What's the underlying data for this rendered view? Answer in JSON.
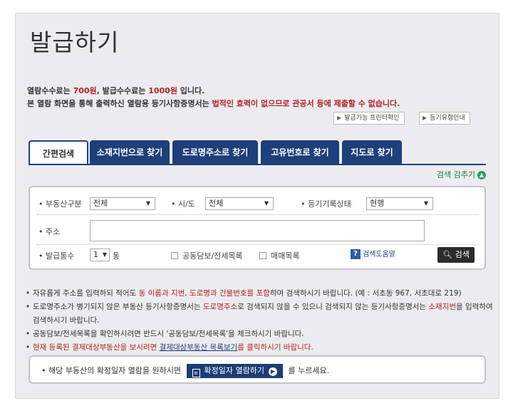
{
  "page_title": "발급하기",
  "notice": {
    "line1_a": "열람수수료는 ",
    "line1_fee1": "700원",
    "line1_b": ", 발급수수료는 ",
    "line1_fee2": "1000원",
    "line1_c": " 입니다.",
    "line2_a": "본 열람 화면을 통해 출력하신 열람용 등기사항증명서는 ",
    "line2_red": "법적인 효력이 없으므로 관공서 등에 제출할 수 없습니다."
  },
  "links": {
    "printer_check": "발급가능 프린터확인",
    "registry_type": "등기유형안내"
  },
  "tabs": [
    "간편검색",
    "소재지번으로 찾기",
    "도로명주소로 찾기",
    "고유번호로 찾기",
    "지도로 찾기"
  ],
  "toggle_label": "검색 감추기",
  "form": {
    "property_type_label": "부동산구분",
    "property_type_value": "전체",
    "region_label": "시/도",
    "region_value": "전체",
    "record_status_label": "등기기록상태",
    "record_status_value": "현행",
    "address_label": "주소",
    "address_value": "",
    "copies_label": "발급통수",
    "copies_value": "1",
    "copies_unit": "통",
    "joint_collateral_label": "공동담보/전세목록",
    "sale_list_label": "매매목록",
    "help_label": "검색도움말",
    "search_label": "검색"
  },
  "bullets": {
    "b1_a": "자유롭게 주소를 입력하되 적어도 ",
    "b1_red": "동 이름과 지번, 도로명과 건물번호를 포함",
    "b1_b": "하여 검색하시기 바랍니다. (예 : 서초동 967, 서초대로 219)",
    "b2_a": "도로명주소가 병기되지 않은 부동산 등기사항증명서는 ",
    "b2_red1": "도로명주소",
    "b2_b": "로 검색되지 않을 수 있으니 검색되지 않는 등기사항증명서는 ",
    "b2_red2": "소재지번",
    "b2_c": "을 입력하여 검색하시기 바랍니다.",
    "b3": "공동담보/전세목록을 확인하시려면 반드시 '공동담보/전세목록'을 체크하시기 바랍니다.",
    "b4_a": "현재 등록된 결제대상부동산을 보시려면 ",
    "b4_link": "결제대상부동산 목록보기",
    "b4_b": "를 클릭하시기 바랍니다."
  },
  "bottom": {
    "text_a": "해당 부동산의 확정일자 열람을 원하시면",
    "button_label": "확정일자 열람하기",
    "text_b": "를 누르세요."
  }
}
